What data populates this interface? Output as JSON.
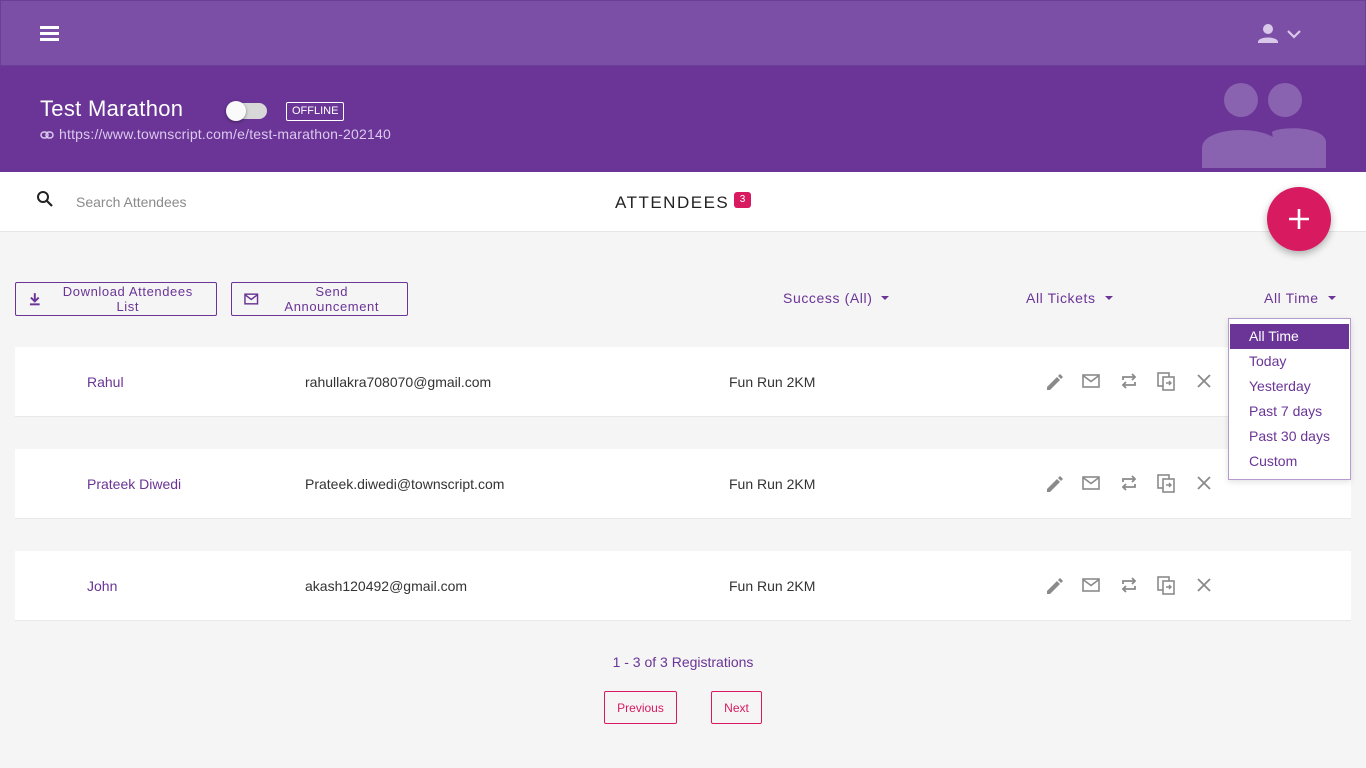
{
  "event": {
    "title": "Test Marathon",
    "status_badge": "OFFLINE",
    "url": "https://www.townscript.com/e/test-marathon-202140"
  },
  "search": {
    "placeholder": "Search Attendees"
  },
  "attendees_header": {
    "title": "ATTENDEES",
    "count": "3"
  },
  "actions": {
    "download_label": "Download Attendees List",
    "announce_label": "Send Announcement"
  },
  "filters": {
    "status": "Success (All)",
    "tickets": "All Tickets",
    "time": "All Time"
  },
  "time_dropdown": {
    "options": [
      "All Time",
      "Today",
      "Yesterday",
      "Past 7 days",
      "Past 30 days",
      "Custom"
    ],
    "selected": "All Time"
  },
  "attendees": [
    {
      "name": "Rahul",
      "email": "rahullakra708070@gmail.com",
      "ticket": "Fun Run 2KM"
    },
    {
      "name": "Prateek Diwedi",
      "email": "Prateek.diwedi@townscript.com",
      "ticket": "Fun Run 2KM"
    },
    {
      "name": "John",
      "email": "akash120492@gmail.com",
      "ticket": "Fun Run 2KM"
    }
  ],
  "pagination": {
    "info": "1 - 3 of 3 Registrations",
    "previous_label": "Previous",
    "next_label": "Next"
  },
  "colors": {
    "topbar": "#7a4fa5",
    "header": "#6a3596",
    "accent": "#d81b60",
    "primary_text": "#6a3596"
  },
  "icons": {
    "menu": "menu-icon",
    "account": "account-icon",
    "link": "link-icon",
    "group": "group-icon",
    "search": "search-icon",
    "add": "plus-icon",
    "download": "download-icon",
    "mail": "mail-icon",
    "edit": "edit-icon",
    "transfer": "transfer-icon",
    "copy": "copy-icon",
    "cancel": "close-icon"
  }
}
